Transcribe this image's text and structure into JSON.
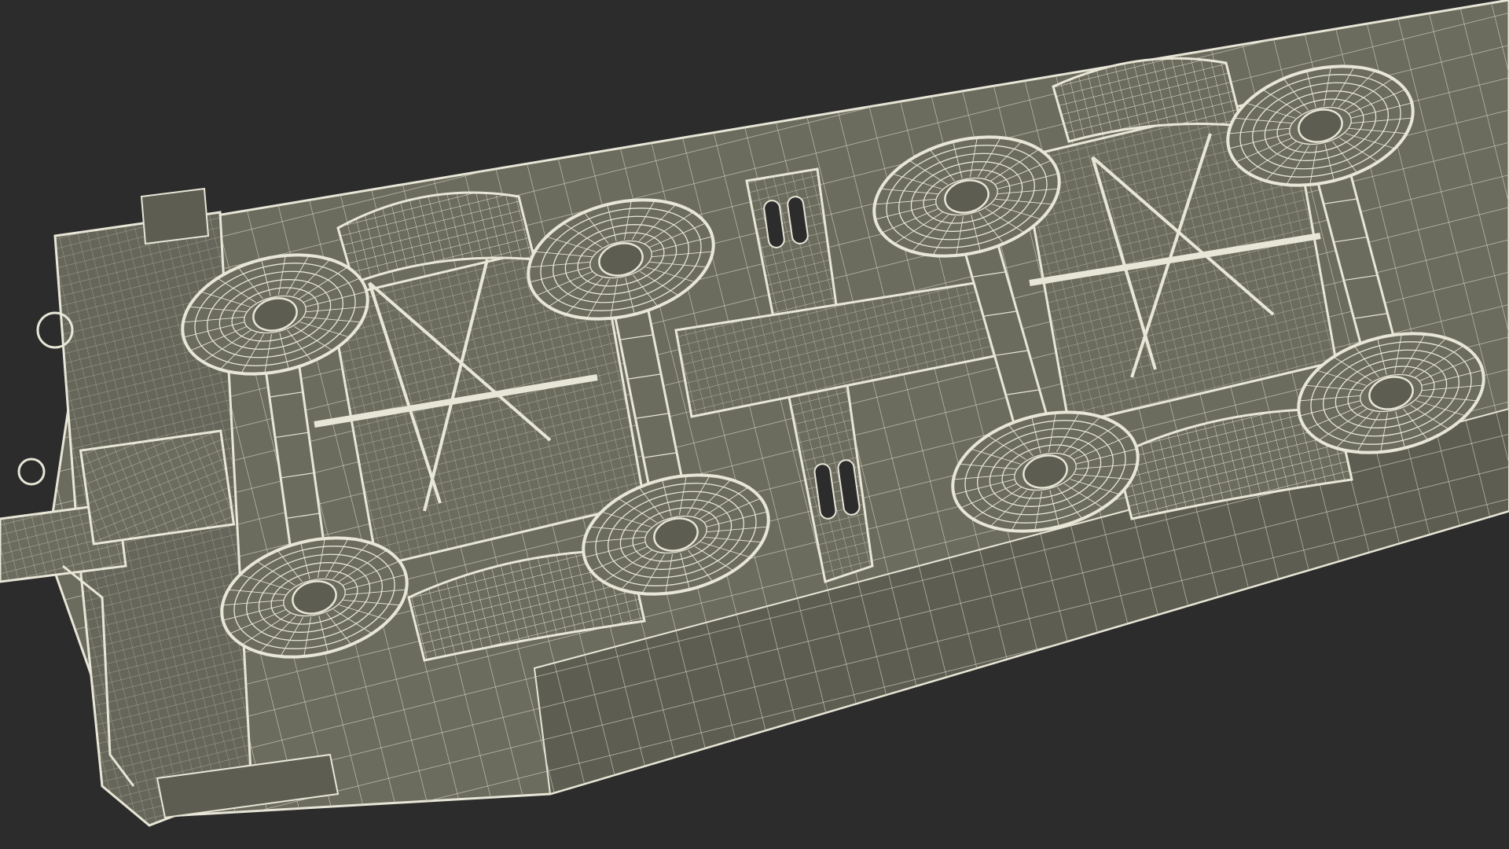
{
  "scene": {
    "subject": "railcar-underframe-wireframe",
    "background_color": "#2c2c2c",
    "surface_color": "#6b6b5e",
    "surface_dark_color": "#5d5d52",
    "wire_color": "#e8e6d6",
    "wire_dim_color": "#cfcdbd",
    "components": [
      "underframe-deck",
      "bogie-left",
      "bogie-right",
      "center-bolster",
      "coupler-end",
      "wheelsets"
    ]
  }
}
